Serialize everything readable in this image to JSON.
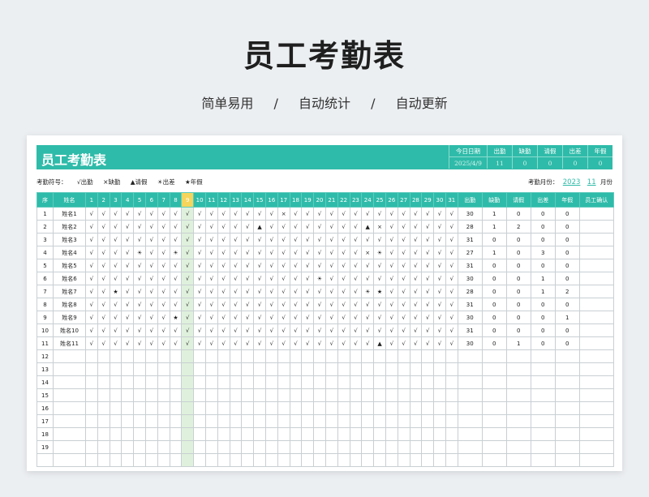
{
  "hero": {
    "title": "员工考勤表",
    "features": [
      "简单易用",
      "/",
      "自动统计",
      "/",
      "自动更新"
    ]
  },
  "sheet": {
    "title": "员工考勤表",
    "summary_headers": [
      "今日日期",
      "出勤",
      "缺勤",
      "请假",
      "出差",
      "年假"
    ],
    "summary_values": [
      "2025/4/9",
      "11",
      "0",
      "0",
      "0",
      "0"
    ],
    "legend_label": "考勤符号：",
    "legend": [
      "√出勤",
      "×缺勤",
      "▲请假",
      "☀出差",
      "★年假"
    ],
    "month_label": "考勤月份：",
    "year": "2023",
    "month": "11",
    "month_suffix": "月份",
    "today_col": 9,
    "headers": {
      "seq": "序",
      "name": "姓名",
      "stats": [
        "出勤",
        "缺勤",
        "请假",
        "出差",
        "年假"
      ],
      "confirm": "员工确认"
    },
    "days": [
      "1",
      "2",
      "3",
      "4",
      "5",
      "6",
      "7",
      "8",
      "9",
      "10",
      "11",
      "12",
      "13",
      "14",
      "15",
      "16",
      "17",
      "18",
      "19",
      "20",
      "21",
      "22",
      "23",
      "24",
      "25",
      "26",
      "27",
      "28",
      "29",
      "30",
      "31"
    ],
    "rows": [
      {
        "seq": "1",
        "name": "姓名1",
        "marks": "√√√√√√√√√√√√√√√√×√√√√√√√√√√√√√√",
        "stats": [
          "30",
          "1",
          "0",
          "0",
          "0"
        ]
      },
      {
        "seq": "2",
        "name": "姓名2",
        "marks": "√√√√√√√√√√√√√√▲√√√√√√√√▲×√√√√√√",
        "stats": [
          "28",
          "1",
          "2",
          "0",
          "0"
        ]
      },
      {
        "seq": "3",
        "name": "姓名3",
        "marks": "√√√√√√√√√√√√√√√√√√√√√√√√√√√√√√√",
        "stats": [
          "31",
          "0",
          "0",
          "0",
          "0"
        ]
      },
      {
        "seq": "4",
        "name": "姓名4",
        "marks": "√√√√☀√√☀√√√√√√√√√√√√√√√×☀√√√√√√",
        "stats": [
          "27",
          "1",
          "0",
          "3",
          "0"
        ]
      },
      {
        "seq": "5",
        "name": "姓名5",
        "marks": "√√√√√√√√√√√√√√√√√√√√√√√√√√√√√√√",
        "stats": [
          "31",
          "0",
          "0",
          "0",
          "0"
        ]
      },
      {
        "seq": "6",
        "name": "姓名6",
        "marks": "√√√√√√√√√√√√√√√√√√√☀√√√√√√√√√√√",
        "stats": [
          "30",
          "0",
          "0",
          "1",
          "0"
        ]
      },
      {
        "seq": "7",
        "name": "姓名7",
        "marks": "√√★√√√√√√√√√√√√√√√√√√√√☀★√√√√√√",
        "stats": [
          "28",
          "0",
          "0",
          "1",
          "2"
        ]
      },
      {
        "seq": "8",
        "name": "姓名8",
        "marks": "√√√√√√√√√√√√√√√√√√√√√√√√√√√√√√√",
        "stats": [
          "31",
          "0",
          "0",
          "0",
          "0"
        ]
      },
      {
        "seq": "9",
        "name": "姓名9",
        "marks": "√√√√√√√★√√√√√√√√√√√√√√√√√√√√√√√",
        "stats": [
          "30",
          "0",
          "0",
          "0",
          "1"
        ]
      },
      {
        "seq": "10",
        "name": "姓名10",
        "marks": "√√√√√√√√√√√√√√√√√√√√√√√√√√√√√√√",
        "stats": [
          "31",
          "0",
          "0",
          "0",
          "0"
        ]
      },
      {
        "seq": "11",
        "name": "姓名11",
        "marks": "√√√√√√√√√√√√√√√√√√√√√√√√▲√√√√√√",
        "stats": [
          "30",
          "0",
          "1",
          "0",
          "0"
        ]
      },
      {
        "seq": "12",
        "name": "",
        "marks": "",
        "stats": [
          "",
          "",
          "",
          "",
          ""
        ]
      },
      {
        "seq": "13",
        "name": "",
        "marks": "",
        "stats": [
          "",
          "",
          "",
          "",
          ""
        ]
      },
      {
        "seq": "14",
        "name": "",
        "marks": "",
        "stats": [
          "",
          "",
          "",
          "",
          ""
        ]
      },
      {
        "seq": "15",
        "name": "",
        "marks": "",
        "stats": [
          "",
          "",
          "",
          "",
          ""
        ]
      },
      {
        "seq": "16",
        "name": "",
        "marks": "",
        "stats": [
          "",
          "",
          "",
          "",
          ""
        ]
      },
      {
        "seq": "17",
        "name": "",
        "marks": "",
        "stats": [
          "",
          "",
          "",
          "",
          ""
        ]
      },
      {
        "seq": "18",
        "name": "",
        "marks": "",
        "stats": [
          "",
          "",
          "",
          "",
          ""
        ]
      },
      {
        "seq": "19",
        "name": "",
        "marks": "",
        "stats": [
          "",
          "",
          "",
          "",
          ""
        ]
      },
      {
        "seq": "",
        "name": "",
        "marks": "",
        "stats": [
          "",
          "",
          "",
          "",
          ""
        ]
      }
    ]
  }
}
